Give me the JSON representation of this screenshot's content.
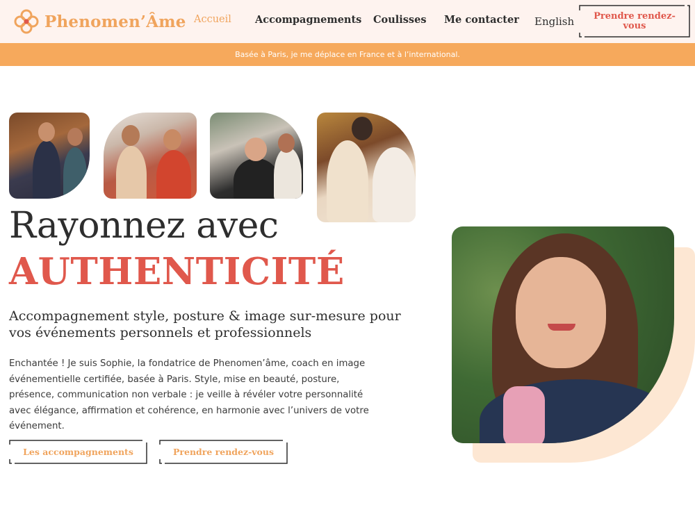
{
  "brand": {
    "name": "Phenomen’Âme",
    "color": "#f0a45d",
    "accent": "#e0584c"
  },
  "nav": {
    "items": [
      {
        "label": "Accueil",
        "active": true
      },
      {
        "label": "Accompagnements",
        "active": false
      },
      {
        "label": "Coulisses",
        "active": false
      },
      {
        "label": "Me contacter",
        "active": false
      }
    ],
    "language": "English",
    "cta": "Prendre rendez-vous"
  },
  "banner": {
    "text": "Basée à Paris, je me déplace en France et à l’international.",
    "bg": "#f6a95c"
  },
  "hero": {
    "line1": "Rayonnez avec",
    "line2": "AUTHENTICITÉ",
    "subtitle": "Accompagnement style, posture & image sur-mesure pour vos événements personnels et professionnels",
    "intro": "Enchantée ! Je suis Sophie, la fondatrice de Phenomen’âme, coach en image événementielle certifiée, basée à Paris. Style, mise en beauté, posture, présence, communication non verbale : je veille à révéler votre personnalité avec élégance, affirmation et cohérence, en harmonie avec l’univers de votre événement.",
    "buttons": {
      "accompagnements": "Les accompagnements",
      "rdv": "Prendre rendez-vous"
    }
  },
  "icons": [
    "logo-mandala-icon"
  ]
}
